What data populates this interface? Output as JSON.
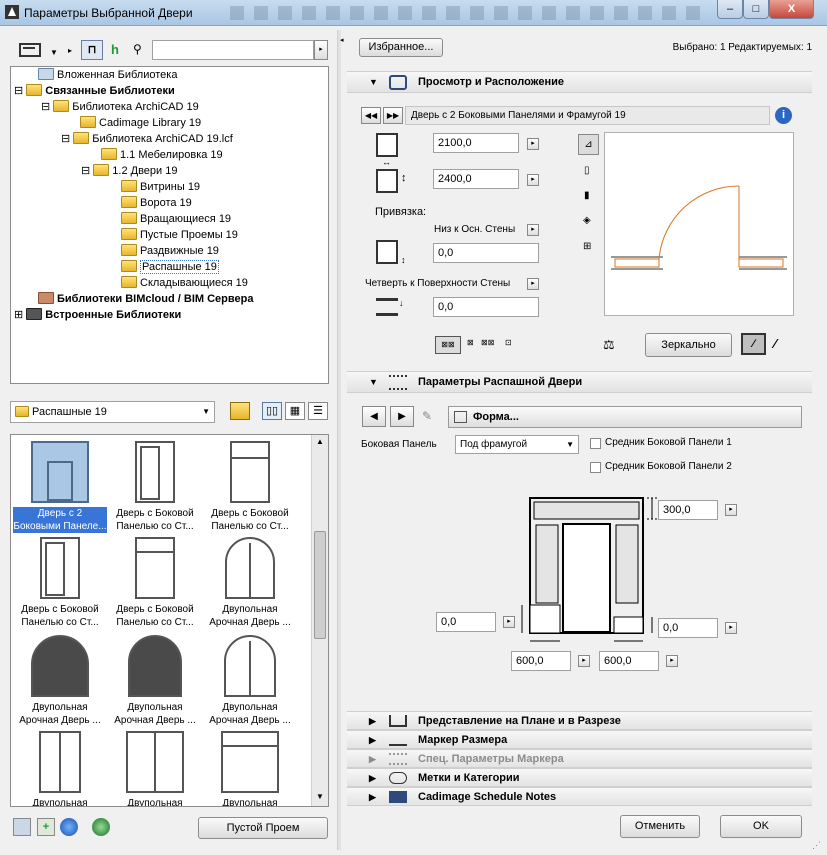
{
  "window": {
    "title": "Параметры Выбранной Двери",
    "minimize": "–",
    "maximize": "□",
    "close": "X"
  },
  "left": {
    "search_placeholder": "",
    "tree": [
      {
        "label": "Вложенная Библиотека",
        "bold": false
      },
      {
        "label": "Связанные Библиотеки",
        "bold": true
      },
      {
        "label": "Библиотека ArchiCAD 19",
        "bold": false
      },
      {
        "label": "Cadimage Library 19",
        "bold": false
      },
      {
        "label": "Библиотека ArchiCAD 19.lcf",
        "bold": false
      },
      {
        "label": "1.1 Мебелировка 19",
        "bold": false
      },
      {
        "label": "1.2 Двери 19",
        "bold": false
      },
      {
        "label": "Витрины 19",
        "bold": false
      },
      {
        "label": "Ворота 19",
        "bold": false
      },
      {
        "label": "Вращающиеся 19",
        "bold": false
      },
      {
        "label": "Пустые Проемы 19",
        "bold": false
      },
      {
        "label": "Раздвижные 19",
        "bold": false
      },
      {
        "label": "Распашные 19",
        "bold": false,
        "selected": true
      },
      {
        "label": "Складывающиеся 19",
        "bold": false
      },
      {
        "label": "Библиотеки BIMcloud / BIM Сервера",
        "bold": true
      },
      {
        "label": "Встроенные Библиотеки",
        "bold": true
      }
    ],
    "folder_dropdown": "Распашные 19",
    "items": [
      {
        "line1": "Дверь с 2",
        "line2": "Боковыми Панеле...",
        "selected": true
      },
      {
        "line1": "Дверь с Боковой",
        "line2": "Панелью со Ст..."
      },
      {
        "line1": "Дверь с Боковой",
        "line2": "Панелью со Ст..."
      },
      {
        "line1": "Дверь с Боковой",
        "line2": "Панелью со Ст..."
      },
      {
        "line1": "Дверь с Боковой",
        "line2": "Панелью со Ст..."
      },
      {
        "line1": "Двупольная",
        "line2": "Арочная Дверь ..."
      },
      {
        "line1": "Двупольная",
        "line2": "Арочная Дверь ..."
      },
      {
        "line1": "Двупольная",
        "line2": "Арочная Дверь ..."
      },
      {
        "line1": "Двупольная",
        "line2": "Арочная Дверь ..."
      },
      {
        "line1": "Двупольная",
        "line2": ""
      },
      {
        "line1": "Двупольная",
        "line2": ""
      },
      {
        "line1": "Двупольная",
        "line2": ""
      }
    ],
    "empty_opening_button": "Пустой Проем"
  },
  "right": {
    "favorites_button": "Избранное...",
    "selection_status": "Выбрано: 1 Редактируемых: 1",
    "preview_section": "Просмотр и Расположение",
    "object_name": "Дверь с 2 Боковыми Панелями и Фрамугой 19",
    "width_value": "2100,0",
    "height_value": "2400,0",
    "anchor_label": "Привязка:",
    "anchor_option": "Низ к Осн. Стены",
    "sill_value": "0,0",
    "reveal_option": "Четверть к Поверхности Стены",
    "reveal_value": "0,0",
    "mirror_button": "Зеркально",
    "door_section": "Параметры Распашной Двери",
    "shape_tab": "Форма...",
    "side_panel_label": "Боковая Панель",
    "side_panel_value": "Под фрамугой",
    "mullion1_label": "Средник Боковой Панели 1",
    "mullion2_label": "Средник Боковой Панели 2",
    "transom_value": "300,0",
    "left_offset_value": "0,0",
    "right_offset_value": "0,0",
    "left_panel_width": "600,0",
    "right_panel_width": "600,0",
    "collapsed_sections": [
      "Представление на Плане и в Разрезе",
      "Маркер Размера",
      "Спец. Параметры Маркера",
      "Метки и Категории",
      "Cadimage Schedule Notes"
    ],
    "cancel_button": "Отменить",
    "ok_button": "OK"
  },
  "colors": {
    "selection": "#3875d7",
    "door_arc": "#d9751c"
  }
}
